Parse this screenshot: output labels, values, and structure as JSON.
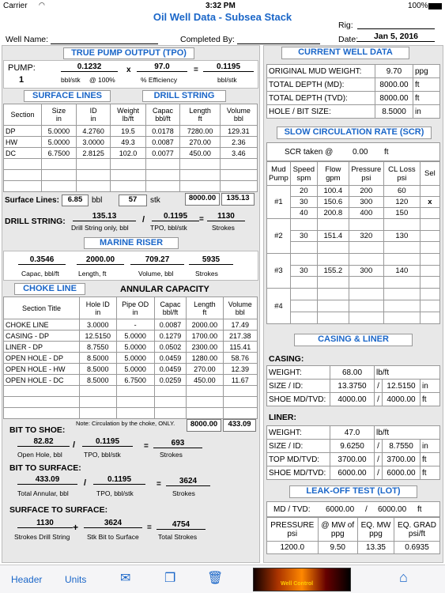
{
  "status": {
    "carrier": "Carrier",
    "time": "3:32 PM",
    "battery": "100%"
  },
  "title": "Oil Well Data - Subsea Stack",
  "rig_label": "Rig:",
  "well_name_label": "Well Name:",
  "completed_by_label": "Completed By:",
  "date_label": "Date:",
  "date_value": "Jan 5, 2016",
  "tpo": {
    "title": "TRUE PUMP OUTPUT (TPO)",
    "pump_label": "PUMP:",
    "pump_num": "1",
    "v1": "0.1232",
    "u1": "bbl/stk",
    "u1b": "@ 100%",
    "x": "x",
    "v2": "97.0",
    "u2": "% Efficiency",
    "eq": "=",
    "v3": "0.1195",
    "u3": "bbl/stk"
  },
  "surf_lines_title": "SURFACE LINES",
  "drill_string_title": "DRILL STRING",
  "ds_headers": [
    [
      "Section",
      ""
    ],
    [
      "Size",
      "in"
    ],
    [
      "ID",
      "in"
    ],
    [
      "Weight",
      "lb/ft"
    ],
    [
      "Capac",
      "bbl/ft"
    ],
    [
      "Length",
      "ft"
    ],
    [
      "Volume",
      "bbl"
    ]
  ],
  "ds_rows": [
    [
      "DP",
      "5.0000",
      "4.2760",
      "19.5",
      "0.0178",
      "7280.00",
      "129.31"
    ],
    [
      "HW",
      "5.0000",
      "3.0000",
      "49.3",
      "0.0087",
      "270.00",
      "2.36"
    ],
    [
      "DC",
      "6.7500",
      "2.8125",
      "102.0",
      "0.0077",
      "450.00",
      "3.46"
    ]
  ],
  "surface_lines": {
    "label": "Surface Lines:",
    "v1": "6.85",
    "u1": "bbl",
    "v2": "57",
    "u2": "stk",
    "t1": "8000.00",
    "t2": "135.13"
  },
  "drill_string_calc": {
    "label": "DRILL STRING:",
    "v1": "135.13",
    "l1": "Drill String only, bbl",
    "slash": "/",
    "v2": "0.1195",
    "l2": "TPO, bbl/stk",
    "eq": "=",
    "v3": "1130",
    "l3": "Strokes"
  },
  "marine_riser": {
    "title": "MARINE RISER",
    "v1": "0.3546",
    "l1": "Capac, bbl/ft",
    "v2": "2000.00",
    "l2": "Length, ft",
    "v3": "709.27",
    "l3": "Volume, bbl",
    "v4": "5935",
    "l4": "Strokes"
  },
  "choke_line_title": "CHOKE LINE",
  "annular_title": "ANNULAR CAPACITY",
  "an_headers": [
    [
      "Section Title",
      ""
    ],
    [
      "Hole ID",
      "in"
    ],
    [
      "Pipe OD",
      "in"
    ],
    [
      "Capac",
      "bbl/ft"
    ],
    [
      "Length",
      "ft"
    ],
    [
      "Volume",
      "bbl"
    ]
  ],
  "an_rows": [
    [
      "CHOKE LINE",
      "3.0000",
      "-",
      "0.0087",
      "2000.00",
      "17.49"
    ],
    [
      "CASING - DP",
      "12.5150",
      "5.0000",
      "0.1279",
      "1700.00",
      "217.38"
    ],
    [
      "LINER - DP",
      "8.7550",
      "5.0000",
      "0.0502",
      "2300.00",
      "115.41"
    ],
    [
      "OPEN HOLE - DP",
      "8.5000",
      "5.0000",
      "0.0459",
      "1280.00",
      "58.76"
    ],
    [
      "OPEN HOLE - HW",
      "8.5000",
      "5.0000",
      "0.0459",
      "270.00",
      "12.39"
    ],
    [
      "OPEN HOLE - DC",
      "8.5000",
      "6.7500",
      "0.0259",
      "450.00",
      "11.67"
    ]
  ],
  "an_note": "Note: Circulation by the choke, ONLY.",
  "an_t1": "8000.00",
  "an_t2": "433.09",
  "bit_to_shoe": {
    "label": "BIT TO SHOE:",
    "v1": "82.82",
    "l1": "Open Hole, bbl",
    "v2": "0.1195",
    "l2": "TPO,   bbl/stk",
    "v3": "693",
    "l3": "Strokes"
  },
  "bit_to_surface": {
    "label": "BIT TO SURFACE:",
    "v1": "433.09",
    "l1": "Total Annular, bbl",
    "v2": "0.1195",
    "l2": "TPO,   bbl/stk",
    "v3": "3624",
    "l3": "Strokes"
  },
  "surface_to_surface": {
    "label": "SURFACE TO SURFACE:",
    "v1": "1130",
    "l1": "Strokes Drill String",
    "plus": "+",
    "v2": "3624",
    "l2": "Stk Bit to Surface",
    "v3": "4754",
    "l3": "Total Strokes"
  },
  "current_well": {
    "title": "CURRENT WELL DATA",
    "rows": [
      [
        "ORIGINAL MUD WEIGHT:",
        "9.70",
        "ppg"
      ],
      [
        "TOTAL DEPTH (MD):",
        "8000.00",
        "ft"
      ],
      [
        "TOTAL DEPTH (TVD):",
        "8000.00",
        "ft"
      ],
      [
        "HOLE / BIT SIZE:",
        "8.5000",
        "in"
      ]
    ]
  },
  "scr": {
    "title": "SLOW CIRCULATION RATE (SCR)",
    "taken_label": "SCR taken @",
    "taken_val": "0.00",
    "taken_unit": "ft",
    "headers": [
      [
        "Mud",
        "Pump"
      ],
      [
        "Speed",
        "spm"
      ],
      [
        "Flow",
        "gpm"
      ],
      [
        "Pressure",
        "psi"
      ],
      [
        "CL Loss",
        "psi"
      ],
      [
        "Sel",
        ""
      ]
    ],
    "pumps": [
      {
        "name": "#1",
        "rows": [
          [
            "20",
            "100.4",
            "200",
            "60",
            ""
          ],
          [
            "30",
            "150.6",
            "300",
            "120",
            "x"
          ],
          [
            "40",
            "200.8",
            "400",
            "150",
            ""
          ]
        ]
      },
      {
        "name": "#2",
        "rows": [
          [
            "",
            "",
            "",
            "",
            ""
          ],
          [
            "30",
            "151.4",
            "320",
            "130",
            ""
          ],
          [
            "",
            "",
            "",
            "",
            ""
          ]
        ]
      },
      {
        "name": "#3",
        "rows": [
          [
            "",
            "",
            "",
            "",
            ""
          ],
          [
            "30",
            "155.2",
            "300",
            "140",
            ""
          ],
          [
            "",
            "",
            "",
            "",
            ""
          ]
        ]
      },
      {
        "name": "#4",
        "rows": [
          [
            "",
            "",
            "",
            "",
            ""
          ],
          [
            "",
            "",
            "",
            "",
            ""
          ],
          [
            "",
            "",
            "",
            "",
            ""
          ]
        ]
      }
    ]
  },
  "casing_liner": {
    "title": "CASING & LINER",
    "casing_label": "CASING:",
    "liner_label": "LINER:",
    "casing": {
      "weight_label": "WEIGHT:",
      "weight": "68.00",
      "weight_unit": "lb/ft",
      "size_label": "SIZE / ID:",
      "size1": "13.3750",
      "size2": "12.5150",
      "size_unit": "in",
      "shoe_label": "SHOE MD/TVD:",
      "shoe1": "4000.00",
      "shoe2": "4000.00",
      "shoe_unit": "ft"
    },
    "liner": {
      "weight_label": "WEIGHT:",
      "weight": "47.0",
      "weight_unit": "lb/ft",
      "size_label": "SIZE / ID:",
      "size1": "9.6250",
      "size2": "8.7550",
      "size_unit": "in",
      "top_label": "TOP MD/TVD:",
      "top1": "3700.00",
      "top2": "3700.00",
      "top_unit": "ft",
      "shoe_label": "SHOE MD/TVD:",
      "shoe1": "6000.00",
      "shoe2": "6000.00",
      "shoe_unit": "ft"
    }
  },
  "lot": {
    "title": "LEAK-OFF TEST (LOT)",
    "md_label": "MD / TVD:",
    "md": "6000.00",
    "tvd": "6000.00",
    "unit": "ft",
    "headers": [
      [
        "PRESSURE",
        "psi"
      ],
      [
        "@ MW of",
        "ppg"
      ],
      [
        "EQ. MW",
        "ppg"
      ],
      [
        "EQ. GRAD",
        "psi/ft"
      ]
    ],
    "values": [
      "1200.0",
      "9.50",
      "13.35",
      "0.6935"
    ]
  },
  "tabbar": {
    "header": "Header",
    "units": "Units",
    "logo_text": "Well Control"
  }
}
